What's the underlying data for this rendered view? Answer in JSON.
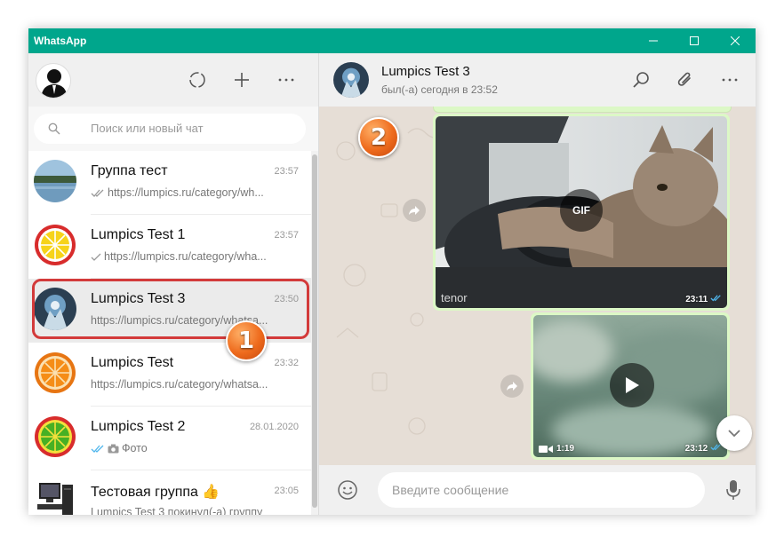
{
  "window": {
    "title": "WhatsApp"
  },
  "sidebar": {
    "search_placeholder": "Поиск или новый чат",
    "chats": [
      {
        "name": "Группа тест",
        "time": "23:57",
        "preview": "https://lumpics.ru/category/wh...",
        "ticks": "double-grey"
      },
      {
        "name": "Lumpics Test 1",
        "time": "23:57",
        "preview": "https://lumpics.ru/category/wha...",
        "ticks": "single"
      },
      {
        "name": "Lumpics Test 3",
        "time": "23:50",
        "preview": "https://lumpics.ru/category/whatsa...",
        "ticks": "none",
        "selected": true
      },
      {
        "name": "Lumpics Test",
        "time": "23:32",
        "preview": "https://lumpics.ru/category/whatsa...",
        "ticks": "none"
      },
      {
        "name": "Lumpics Test 2",
        "time": "28.01.2020",
        "preview": "Фото",
        "ticks": "double-blue"
      },
      {
        "name": "Тестовая группа 👍",
        "time": "23:05",
        "preview": "Lumpics Test 3 покинул(-а) группу",
        "ticks": "none"
      }
    ]
  },
  "chat": {
    "title": "Lumpics Test 3",
    "status": "был(-а) сегодня в 23:52",
    "messages": [
      {
        "type": "gif",
        "label": "GIF",
        "source": "tenor",
        "time": "23:11"
      },
      {
        "type": "video",
        "duration": "1:19",
        "time": "23:12"
      }
    ],
    "input_placeholder": "Введите сообщение"
  },
  "annotations": [
    {
      "label": "1"
    },
    {
      "label": "2"
    }
  ],
  "colors": {
    "accent": "#00a68c",
    "outgoing_bubble": "#dcf8c6",
    "chat_bg": "#e5ddd5",
    "annotation": "#d33a3a"
  }
}
